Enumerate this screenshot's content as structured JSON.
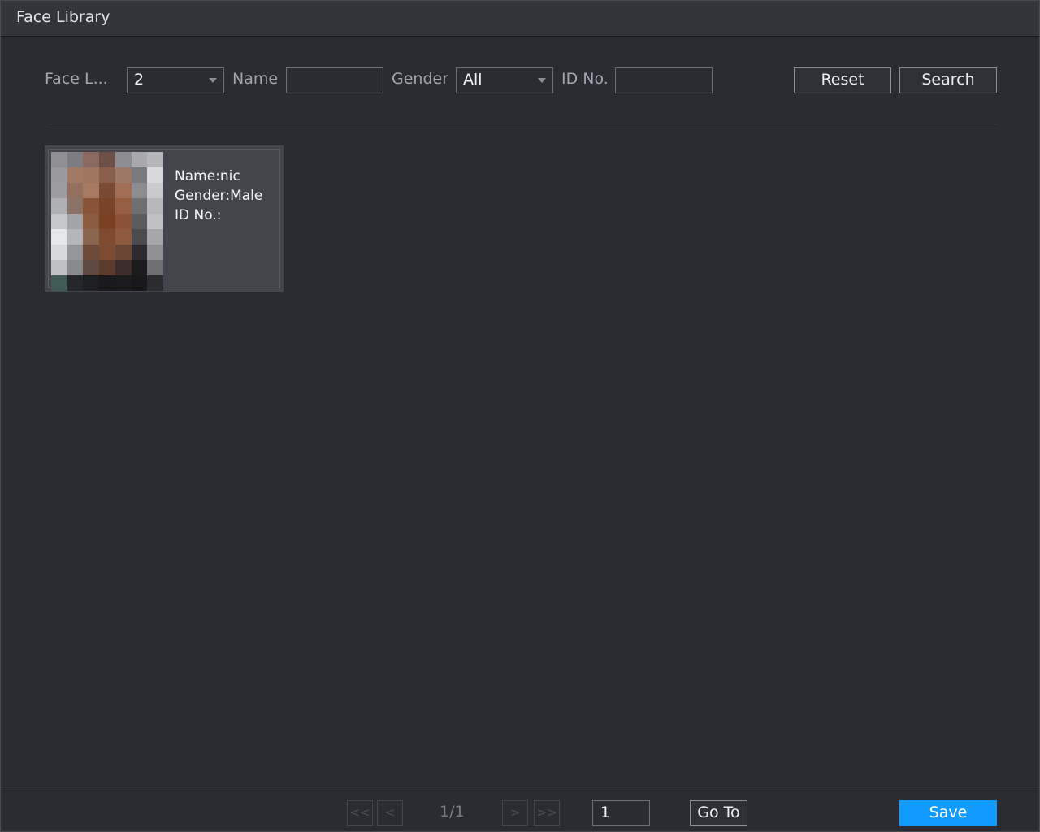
{
  "window": {
    "title": "Face Library"
  },
  "filters": {
    "face_library_label": "Face L...",
    "face_library_value": "2",
    "name_label": "Name",
    "name_value": "",
    "gender_label": "Gender",
    "gender_value": "All",
    "id_label": "ID No.",
    "id_value": ""
  },
  "buttons": {
    "reset": "Reset",
    "search": "Search",
    "goto": "Go To",
    "save": "Save"
  },
  "results": [
    {
      "name": "Name:nic",
      "gender": "Gender:Male",
      "id": "ID No.:"
    }
  ],
  "pagination": {
    "first": "<<",
    "prev": "<",
    "next": ">",
    "last": ">>",
    "page_info": "1/1",
    "goto_value": "1"
  },
  "colors": {
    "accent": "#129bff",
    "background": "#2a2b33",
    "titlebar": "#34353c"
  },
  "icons": {
    "dropdown": "caret-down-icon"
  }
}
